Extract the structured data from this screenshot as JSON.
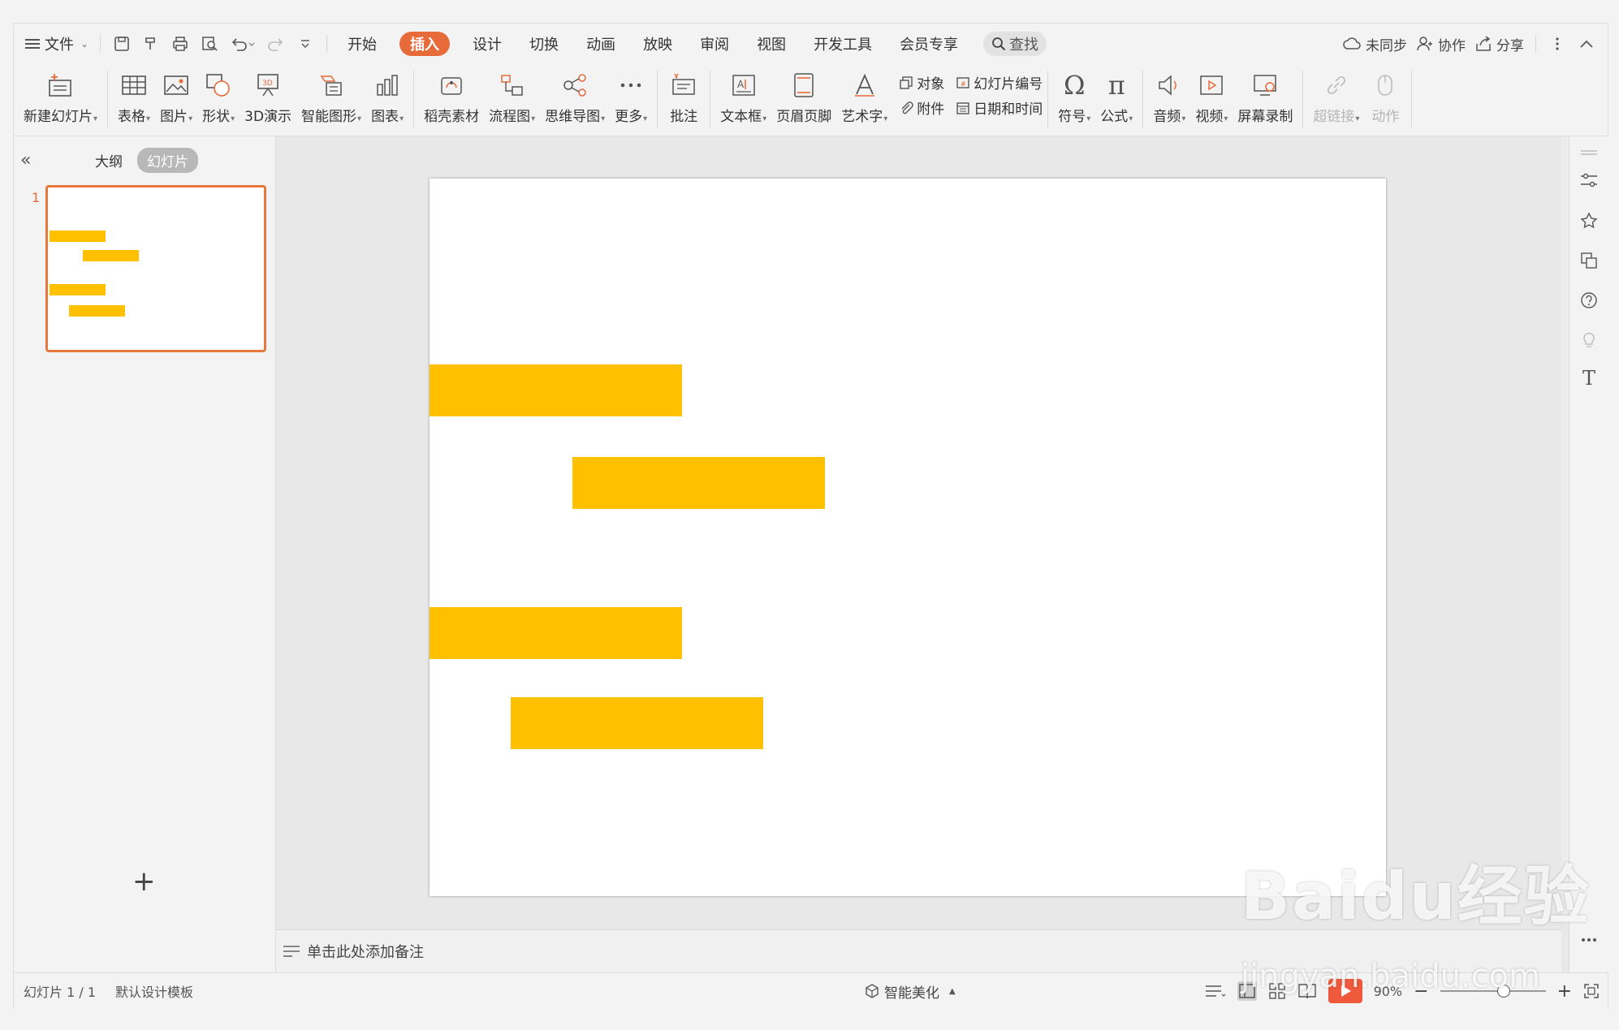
{
  "menu": {
    "file_label": "文件",
    "tabs": [
      "开始",
      "插入",
      "设计",
      "切换",
      "动画",
      "放映",
      "审阅",
      "视图",
      "开发工具",
      "会员专享"
    ],
    "active_tab": "插入",
    "search_label": "查找",
    "sync_label": "未同步",
    "collab_label": "协作",
    "share_label": "分享"
  },
  "ribbon": {
    "new_slide": "新建幻灯片",
    "table": "表格",
    "picture": "图片",
    "shape": "形状",
    "demo3d": "3D演示",
    "smartart": "智能图形",
    "chart": "图表",
    "docer": "稻壳素材",
    "flowchart": "流程图",
    "mindmap": "思维导图",
    "more": "更多",
    "comment": "批注",
    "textbox": "文本框",
    "header_footer": "页眉页脚",
    "wordart": "艺术字",
    "object": "对象",
    "slide_number": "幻灯片编号",
    "attachment": "附件",
    "datetime": "日期和时间",
    "symbol": "符号",
    "formula": "公式",
    "audio": "音频",
    "video": "视频",
    "screen_record": "屏幕录制",
    "hyperlink": "超链接",
    "action": "动作"
  },
  "left_panel": {
    "outline_tab": "大纲",
    "slides_tab": "幻灯片",
    "slide_number": "1"
  },
  "notes_placeholder": "单击此处添加备注",
  "status": {
    "slide_counter": "幻灯片 1 / 1",
    "template": "默认设计模板",
    "beautify": "智能美化",
    "zoom": "90%"
  },
  "watermark": {
    "logo": "Baidu经验",
    "url": "jingyan.baidu.com"
  },
  "colors": {
    "accent": "#e66a3a",
    "bar": "#ffc000"
  }
}
